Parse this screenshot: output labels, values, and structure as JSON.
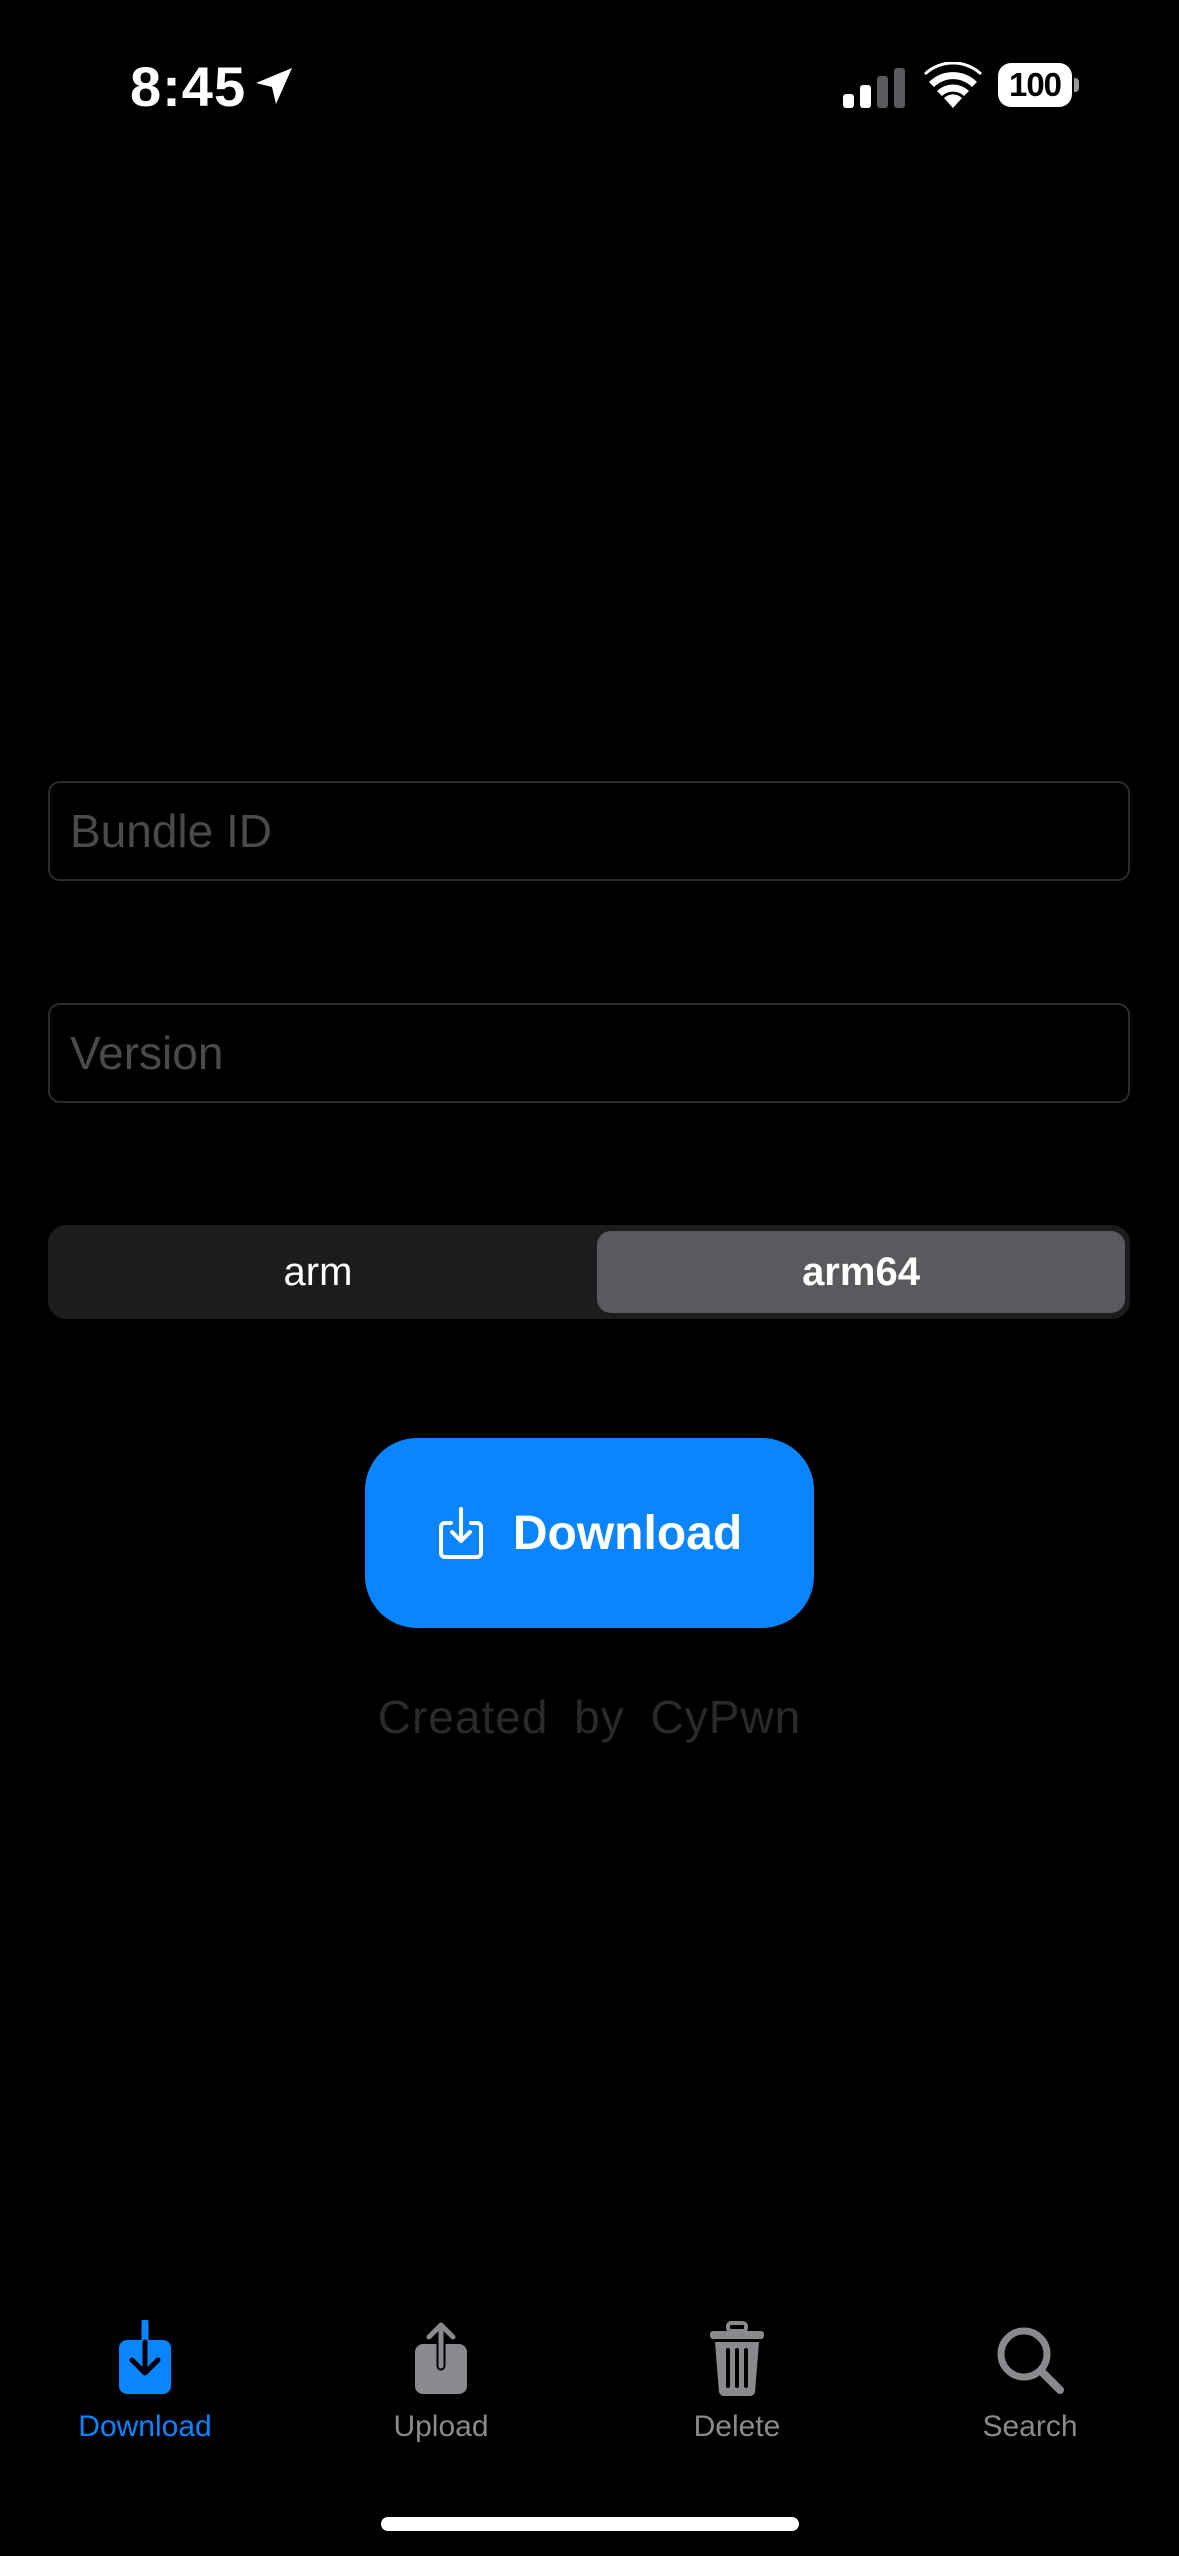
{
  "status_bar": {
    "time": "8:45",
    "battery": "100",
    "icons": [
      "location-arrow-icon",
      "cellular-signal-icon",
      "wifi-icon",
      "battery-icon"
    ]
  },
  "form": {
    "bundle_id_placeholder": "Bundle ID",
    "version_placeholder": "Version",
    "architecture": {
      "options": [
        "arm",
        "arm64"
      ],
      "selected": "arm64"
    }
  },
  "download_button": {
    "label": "Download",
    "icon": "download-tray-icon"
  },
  "credit": "Created  by  CyPwn",
  "tab_bar": {
    "tabs": [
      {
        "label": "Download",
        "icon": "download-icon",
        "active": true
      },
      {
        "label": "Upload",
        "icon": "upload-icon",
        "active": false
      },
      {
        "label": "Delete",
        "icon": "trash-icon",
        "active": false
      },
      {
        "label": "Search",
        "icon": "search-icon",
        "active": false
      }
    ]
  },
  "colors": {
    "background": "#000000",
    "accent": "#0a84ff",
    "inactive_tab": "#8a8a8e",
    "field_border": "#2c2c2e",
    "segment_selected": "#5a5a5e"
  }
}
